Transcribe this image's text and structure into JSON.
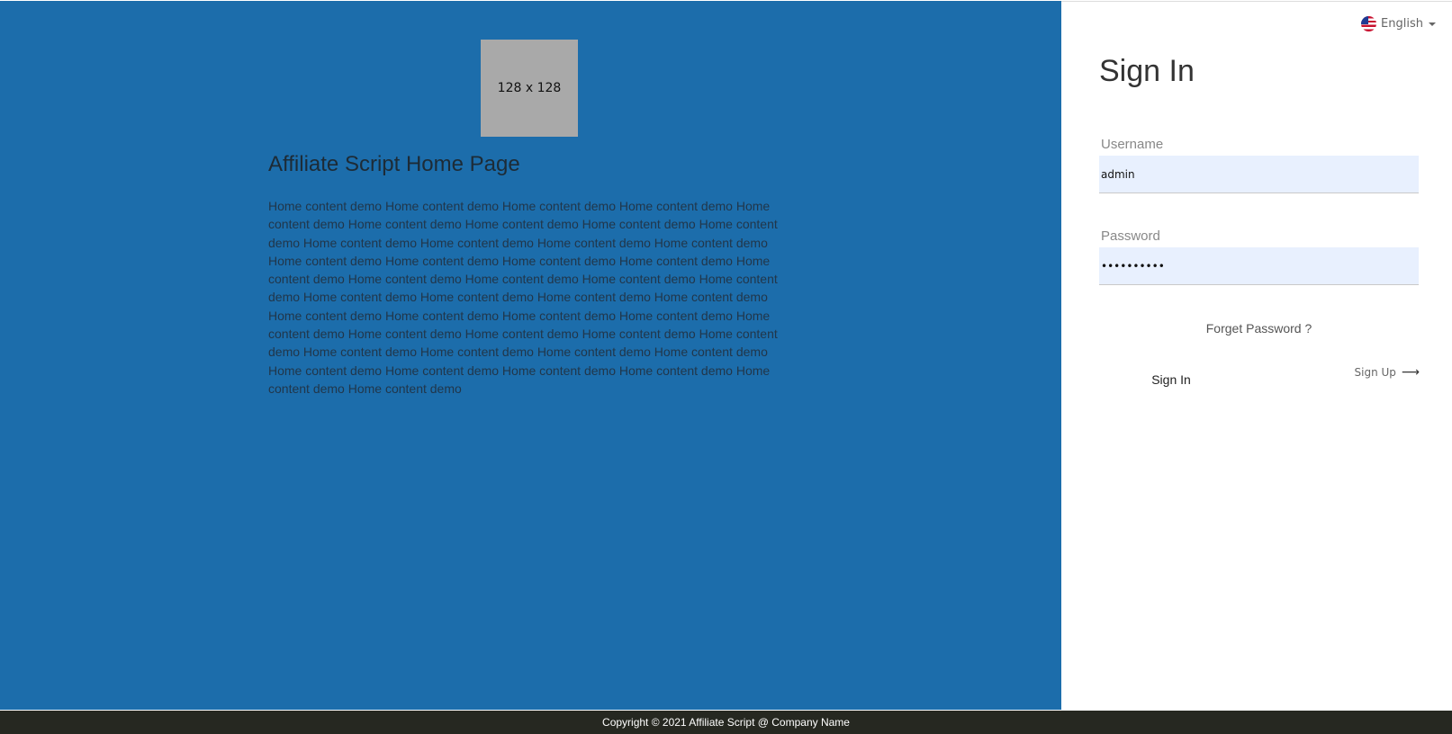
{
  "home": {
    "image_placeholder": "128 x 128",
    "title": "Affiliate Script Home Page",
    "content": "Home content demo Home content demo Home content demo Home content demo Home content demo Home content demo Home content demo Home content demo Home content demo Home content demo Home content demo Home content demo Home content demo Home content demo Home content demo Home content demo Home content demo Home content demo Home content demo Home content demo Home content demo Home content demo Home content demo Home content demo Home content demo Home content demo Home content demo Home content demo Home content demo Home content demo Home content demo Home content demo Home content demo Home content demo Home content demo Home content demo Home content demo Home content demo Home content demo Home content demo Home content demo Home content demo Home content demo Home content demo Home content demo"
  },
  "language": {
    "selected": "English",
    "flag_icon": "us-flag-icon"
  },
  "signin": {
    "title": "Sign In",
    "username_label": "Username",
    "username_value": "admin",
    "password_label": "Password",
    "password_value": "••••••••••",
    "forgot_label": "Forget Password ?",
    "submit_label": "Sign In",
    "signup_label": "Sign Up",
    "signup_icon": "arrow-right-icon"
  },
  "footer": {
    "copyright": "Copyright © 2021 Affiliate Script @ Company Name"
  },
  "colors": {
    "left_panel": "#1c6dab",
    "footer_bg": "#262821",
    "input_bg": "#e8f0fe"
  }
}
